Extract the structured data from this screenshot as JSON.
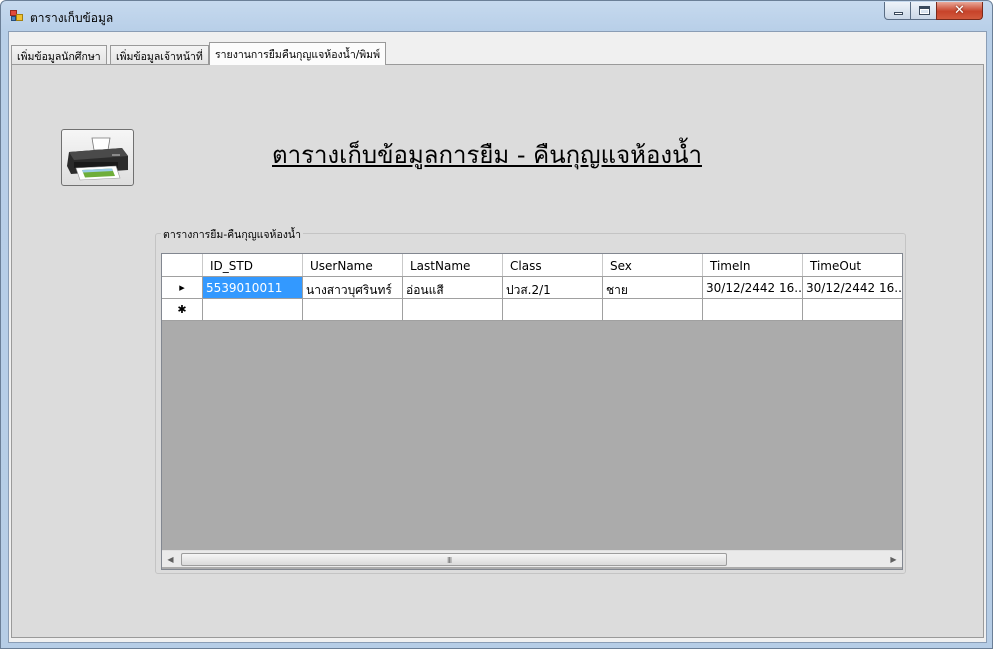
{
  "window": {
    "title": "ตารางเก็บข้อมูล",
    "minimize_label": "",
    "maximize_label": "",
    "close_label": "✕"
  },
  "tabs": [
    {
      "label": "เพิ่มข้อมูลนักศึกษา"
    },
    {
      "label": "เพิ่มข้อมูลเจ้าหน้าที่"
    },
    {
      "label": "รายงานการยืมคืนกุญแจห้องน้ำ/พิมพ์",
      "active": true
    }
  ],
  "report": {
    "heading": "ตารางเก็บข้อมูลการยืม - คืนกุญแจห้องน้ำ",
    "group_label": "ตารางการยืม-คืนกุญแจห้องน้ำ",
    "print_button_icon": "printer-icon"
  },
  "grid": {
    "columns": [
      "ID_STD",
      "UserName",
      "LastName",
      "Class",
      "Sex",
      "TimeIn",
      "TimeOut"
    ],
    "rows": [
      {
        "indicator": "▸",
        "cells": [
          "5539010011",
          "นางสาวบุศรินทร์",
          "อ่อนแสี",
          "ปวส.2/1",
          "ชาย",
          "30/12/2442 16...",
          "30/12/2442 16..."
        ]
      },
      {
        "indicator": "✱",
        "cells": [
          "",
          "",
          "",
          "",
          "",
          "",
          ""
        ]
      }
    ],
    "scroll_grip": "III"
  },
  "colors": {
    "selected_cell": "#3399ff",
    "grid_background": "#ababab",
    "panel_background": "#dcdcdc"
  }
}
